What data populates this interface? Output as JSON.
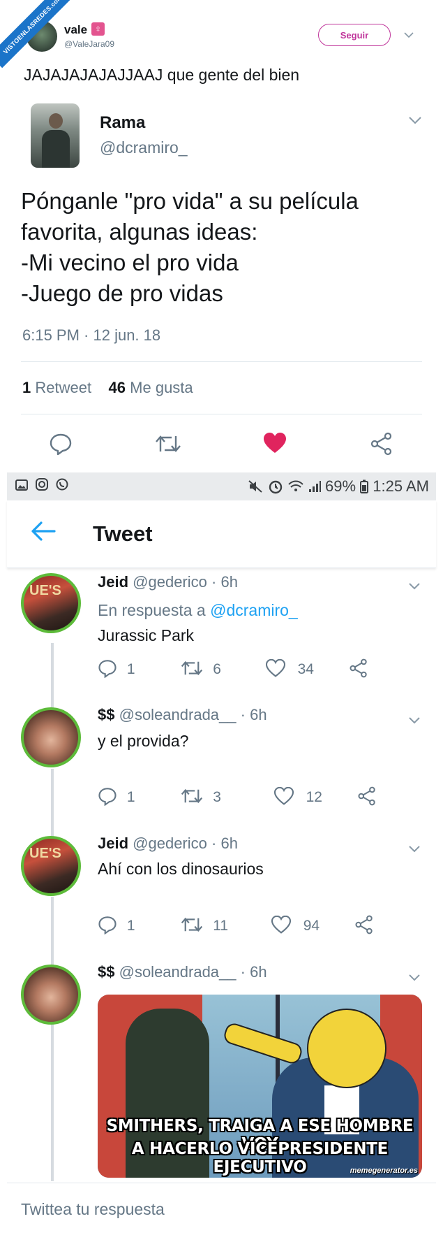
{
  "watermark": "VISTOENLASREDES.com",
  "top_tweet": {
    "author_name": "vale",
    "author_badge": "♀",
    "author_handle": "@ValeJara09",
    "follow_label": "Seguir",
    "text": "JAJAJAJAJAJJAAJ que gente del bien"
  },
  "quoted_tweet": {
    "author_name": "Rama",
    "author_handle": "@dcramiro_",
    "text": "Pónganle \"pro vida\" a su película favorita, algunas ideas:\n-Mi vecino el pro vida\n-Juego de pro vidas",
    "timestamp": "6:15 PM · 12 jun. 18",
    "retweets_count": "1",
    "retweets_label": "Retweet",
    "likes_count": "46",
    "likes_label": "Me gusta"
  },
  "status_bar": {
    "battery": "69%",
    "time": "1:25 AM"
  },
  "header": {
    "title": "Tweet"
  },
  "replies": [
    {
      "name": "Jeid",
      "handle": "@gederico",
      "time": "· 6h",
      "reply_prefix": "En respuesta a",
      "reply_to": "@dcramiro_",
      "text": "Jurassic Park",
      "replies": "1",
      "retweets": "6",
      "likes": "34",
      "avatar_sign": "UE'S"
    },
    {
      "name": "$$",
      "handle": "@soleandrada__",
      "time": "· 6h",
      "text": "y el provida?",
      "replies": "1",
      "retweets": "3",
      "likes": "12"
    },
    {
      "name": "Jeid",
      "handle": "@gederico",
      "time": "· 6h",
      "text": "Ahí con los dinosaurios",
      "replies": "1",
      "retweets": "11",
      "likes": "94",
      "avatar_sign": "UE'S"
    },
    {
      "name": "$$",
      "handle": "@soleandrada__",
      "time": "· 6h",
      "meme_caption_1": "SMITHERS, TRAIGA A ESE HOMBRE VOY",
      "meme_caption_2": "A HACERLO VICEPRESIDENTE EJECUTIVO",
      "meme_credit": "memegenerator.es"
    }
  ],
  "reply_box": {
    "placeholder": "Twittea tu respuesta"
  },
  "colors": {
    "twitter_blue": "#1da1f2",
    "like_red": "#e0245e",
    "follow_magenta": "#c0369b",
    "avatar_ring_green": "#5dbb3a"
  }
}
